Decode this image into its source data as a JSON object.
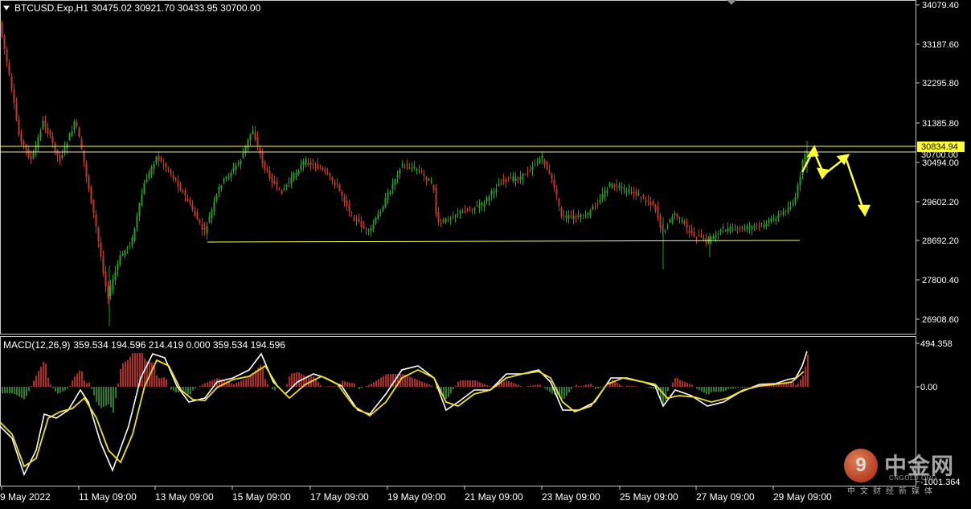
{
  "header": {
    "symbol": "BTCUSD.Exp,H1",
    "ohlc": "30475.02 30921.70 30433.95 30700.00"
  },
  "price_axis": {
    "labels": [
      "34079.40",
      "33187.60",
      "32295.80",
      "31385.80",
      "30494.00",
      "29602.20",
      "28692.20",
      "27800.40",
      "26908.60"
    ],
    "current_price": "30834.94",
    "hidden_label": "30700.00"
  },
  "macd": {
    "title": "MACD(12,26,9)",
    "values": "359.534 194.596 214.419 0.000 359.534 194.596",
    "axis_labels": [
      "494.358",
      "0.00",
      "-1001.364"
    ]
  },
  "time_axis": {
    "labels": [
      "9 May 2022",
      "11 May 09:00",
      "13 May 09:00",
      "15 May 09:00",
      "17 May 09:00",
      "19 May 09:00",
      "21 May 09:00",
      "23 May 09:00",
      "25 May 09:00",
      "27 May 09:00",
      "29 May 09:00"
    ]
  },
  "watermark": {
    "glyph": "9",
    "name": "中金网",
    "domain": "CNGOLD.ORG",
    "tagline": "中文财经新媒体"
  },
  "colors": {
    "background": "#000000",
    "bull_candle": "#2e9b2e",
    "bear_candle": "#c0392b",
    "level_line": "#ffff4d",
    "signal_line": "#f0e020",
    "macd_line": "#ffffff",
    "hist_pos": "#b02a2a",
    "hist_neg": "#2f7a2f",
    "grid_frame": "#c8c8c8"
  }
}
